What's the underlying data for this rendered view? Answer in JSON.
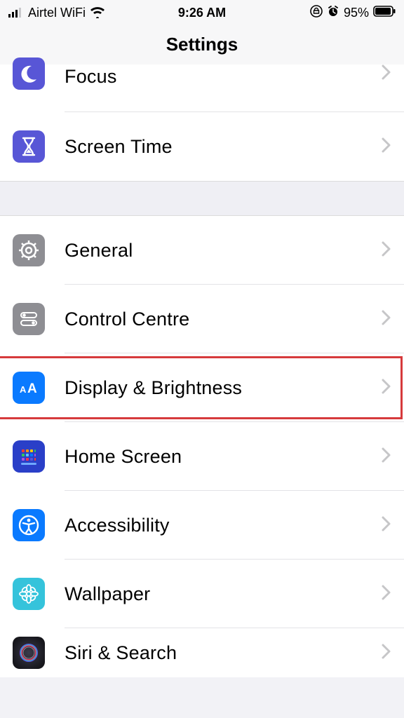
{
  "status": {
    "carrier": "Airtel WiFi",
    "time": "9:26 AM",
    "battery_pct": "95%"
  },
  "navbar": {
    "title": "Settings"
  },
  "sections": {
    "group1": [
      {
        "key": "focus",
        "label": "Focus"
      },
      {
        "key": "screen-time",
        "label": "Screen Time"
      }
    ],
    "group2": [
      {
        "key": "general",
        "label": "General"
      },
      {
        "key": "control-centre",
        "label": "Control Centre"
      },
      {
        "key": "display-brightness",
        "label": "Display & Brightness",
        "highlighted": true
      },
      {
        "key": "home-screen",
        "label": "Home Screen"
      },
      {
        "key": "accessibility",
        "label": "Accessibility"
      },
      {
        "key": "wallpaper",
        "label": "Wallpaper"
      },
      {
        "key": "siri-search",
        "label": "Siri & Search"
      }
    ]
  },
  "icons": {
    "focus": {
      "bg": "#5856d6"
    },
    "screen-time": {
      "bg": "#5856d6"
    },
    "general": {
      "bg": "#8e8e93"
    },
    "control-centre": {
      "bg": "#8e8e93"
    },
    "display-brightness": {
      "bg": "#0a7aff"
    },
    "home-screen": {
      "bg": "#2a3fc8"
    },
    "accessibility": {
      "bg": "#0a7aff"
    },
    "wallpaper": {
      "bg": "#35c3db"
    },
    "siri-search": {
      "bg": "#1a1a1f"
    }
  }
}
